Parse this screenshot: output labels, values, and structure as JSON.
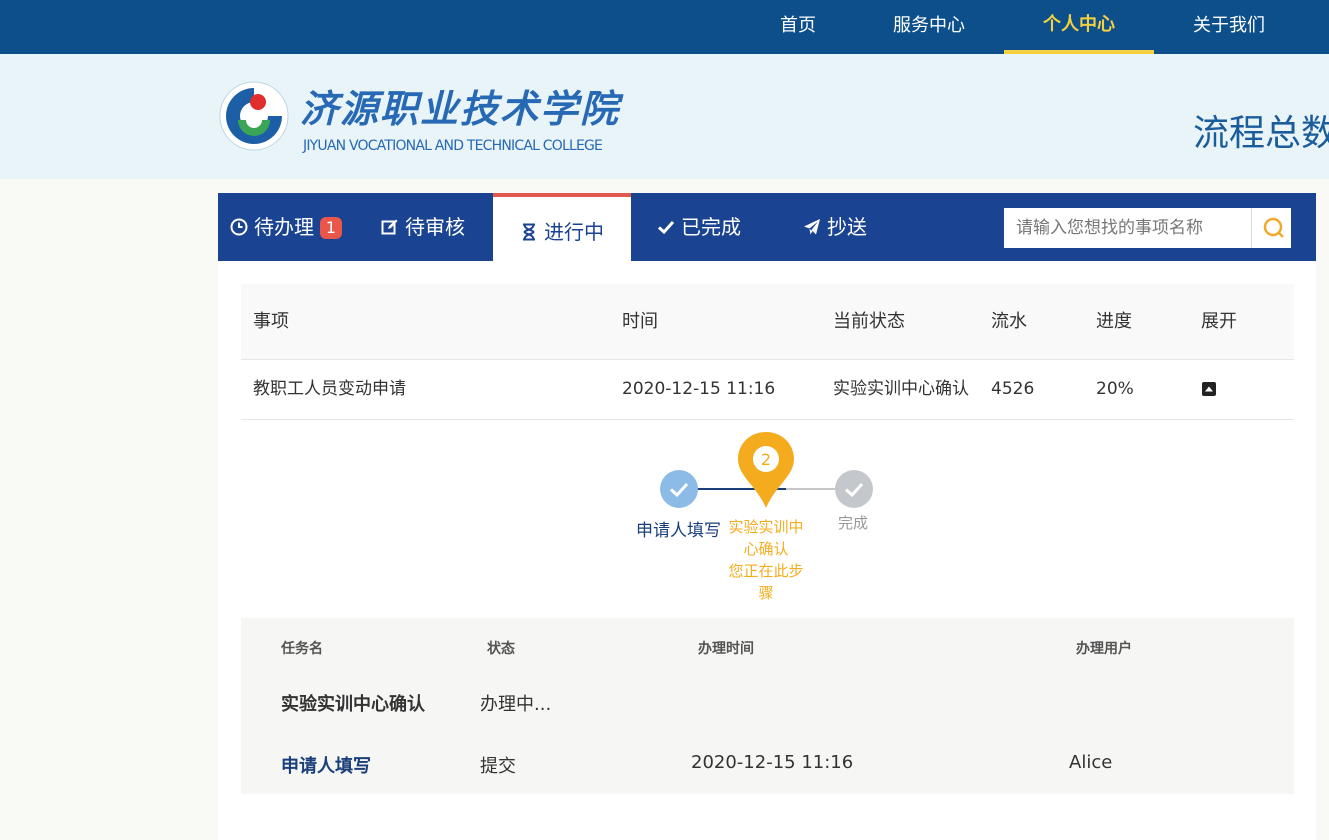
{
  "nav": {
    "items": [
      {
        "label": "首页"
      },
      {
        "label": "服务中心"
      },
      {
        "label": "个人中心"
      },
      {
        "label": "关于我们"
      }
    ],
    "active_index": 2
  },
  "header": {
    "school_cn": "济源职业技术学院",
    "school_en": "JIYUAN VOCATIONAL AND TECHNICAL COLLEGE",
    "flow_total": "流程总数"
  },
  "tabs": {
    "pending": {
      "label": "待办理",
      "badge": "1",
      "icon": "clock-icon"
    },
    "review": {
      "label": "待审核",
      "icon": "edit-icon"
    },
    "in_progress": {
      "label": "进行中",
      "icon": "hourglass-icon"
    },
    "done": {
      "label": "已完成",
      "icon": "check-icon"
    },
    "cc": {
      "label": "抄送",
      "icon": "paper-plane-icon"
    }
  },
  "search": {
    "placeholder": "请输入您想找的事项名称",
    "icon": "search-icon"
  },
  "table": {
    "headers": {
      "item": "事项",
      "time": "时间",
      "status": "当前状态",
      "serial": "流水",
      "progress": "进度",
      "expand": "展开"
    },
    "row": {
      "item": "教职工人员变动申请",
      "time": "2020-12-15 11:16",
      "status": "实验实训中心确认",
      "serial": "4526",
      "progress": "20%"
    }
  },
  "steps": {
    "step1": {
      "label": "申请人填写",
      "state": "done"
    },
    "step2": {
      "number": "2",
      "label": "实验实训中心确认",
      "note": "您正在此步骤",
      "state": "current"
    },
    "step3": {
      "label": "完成",
      "state": "pending"
    }
  },
  "tasks": {
    "headers": {
      "name": "任务名",
      "status": "状态",
      "time": "办理时间",
      "user": "办理用户"
    },
    "rows": [
      {
        "name": "实验实训中心确认",
        "status": "办理中...",
        "time": "",
        "user": ""
      },
      {
        "name": "申请人填写",
        "status": "提交",
        "time": "2020-12-15 11:16",
        "user": "Alice"
      }
    ]
  },
  "colors": {
    "nav_bg": "#0c4f8a",
    "nav_active": "#f5d142",
    "tab_bg": "#1a4392",
    "tab_active_border": "#e05a4f",
    "badge": "#e8574a",
    "current_step": "#f4ac1e",
    "done_step": "#8bbbe6",
    "pending_step": "#c4c8cd"
  }
}
